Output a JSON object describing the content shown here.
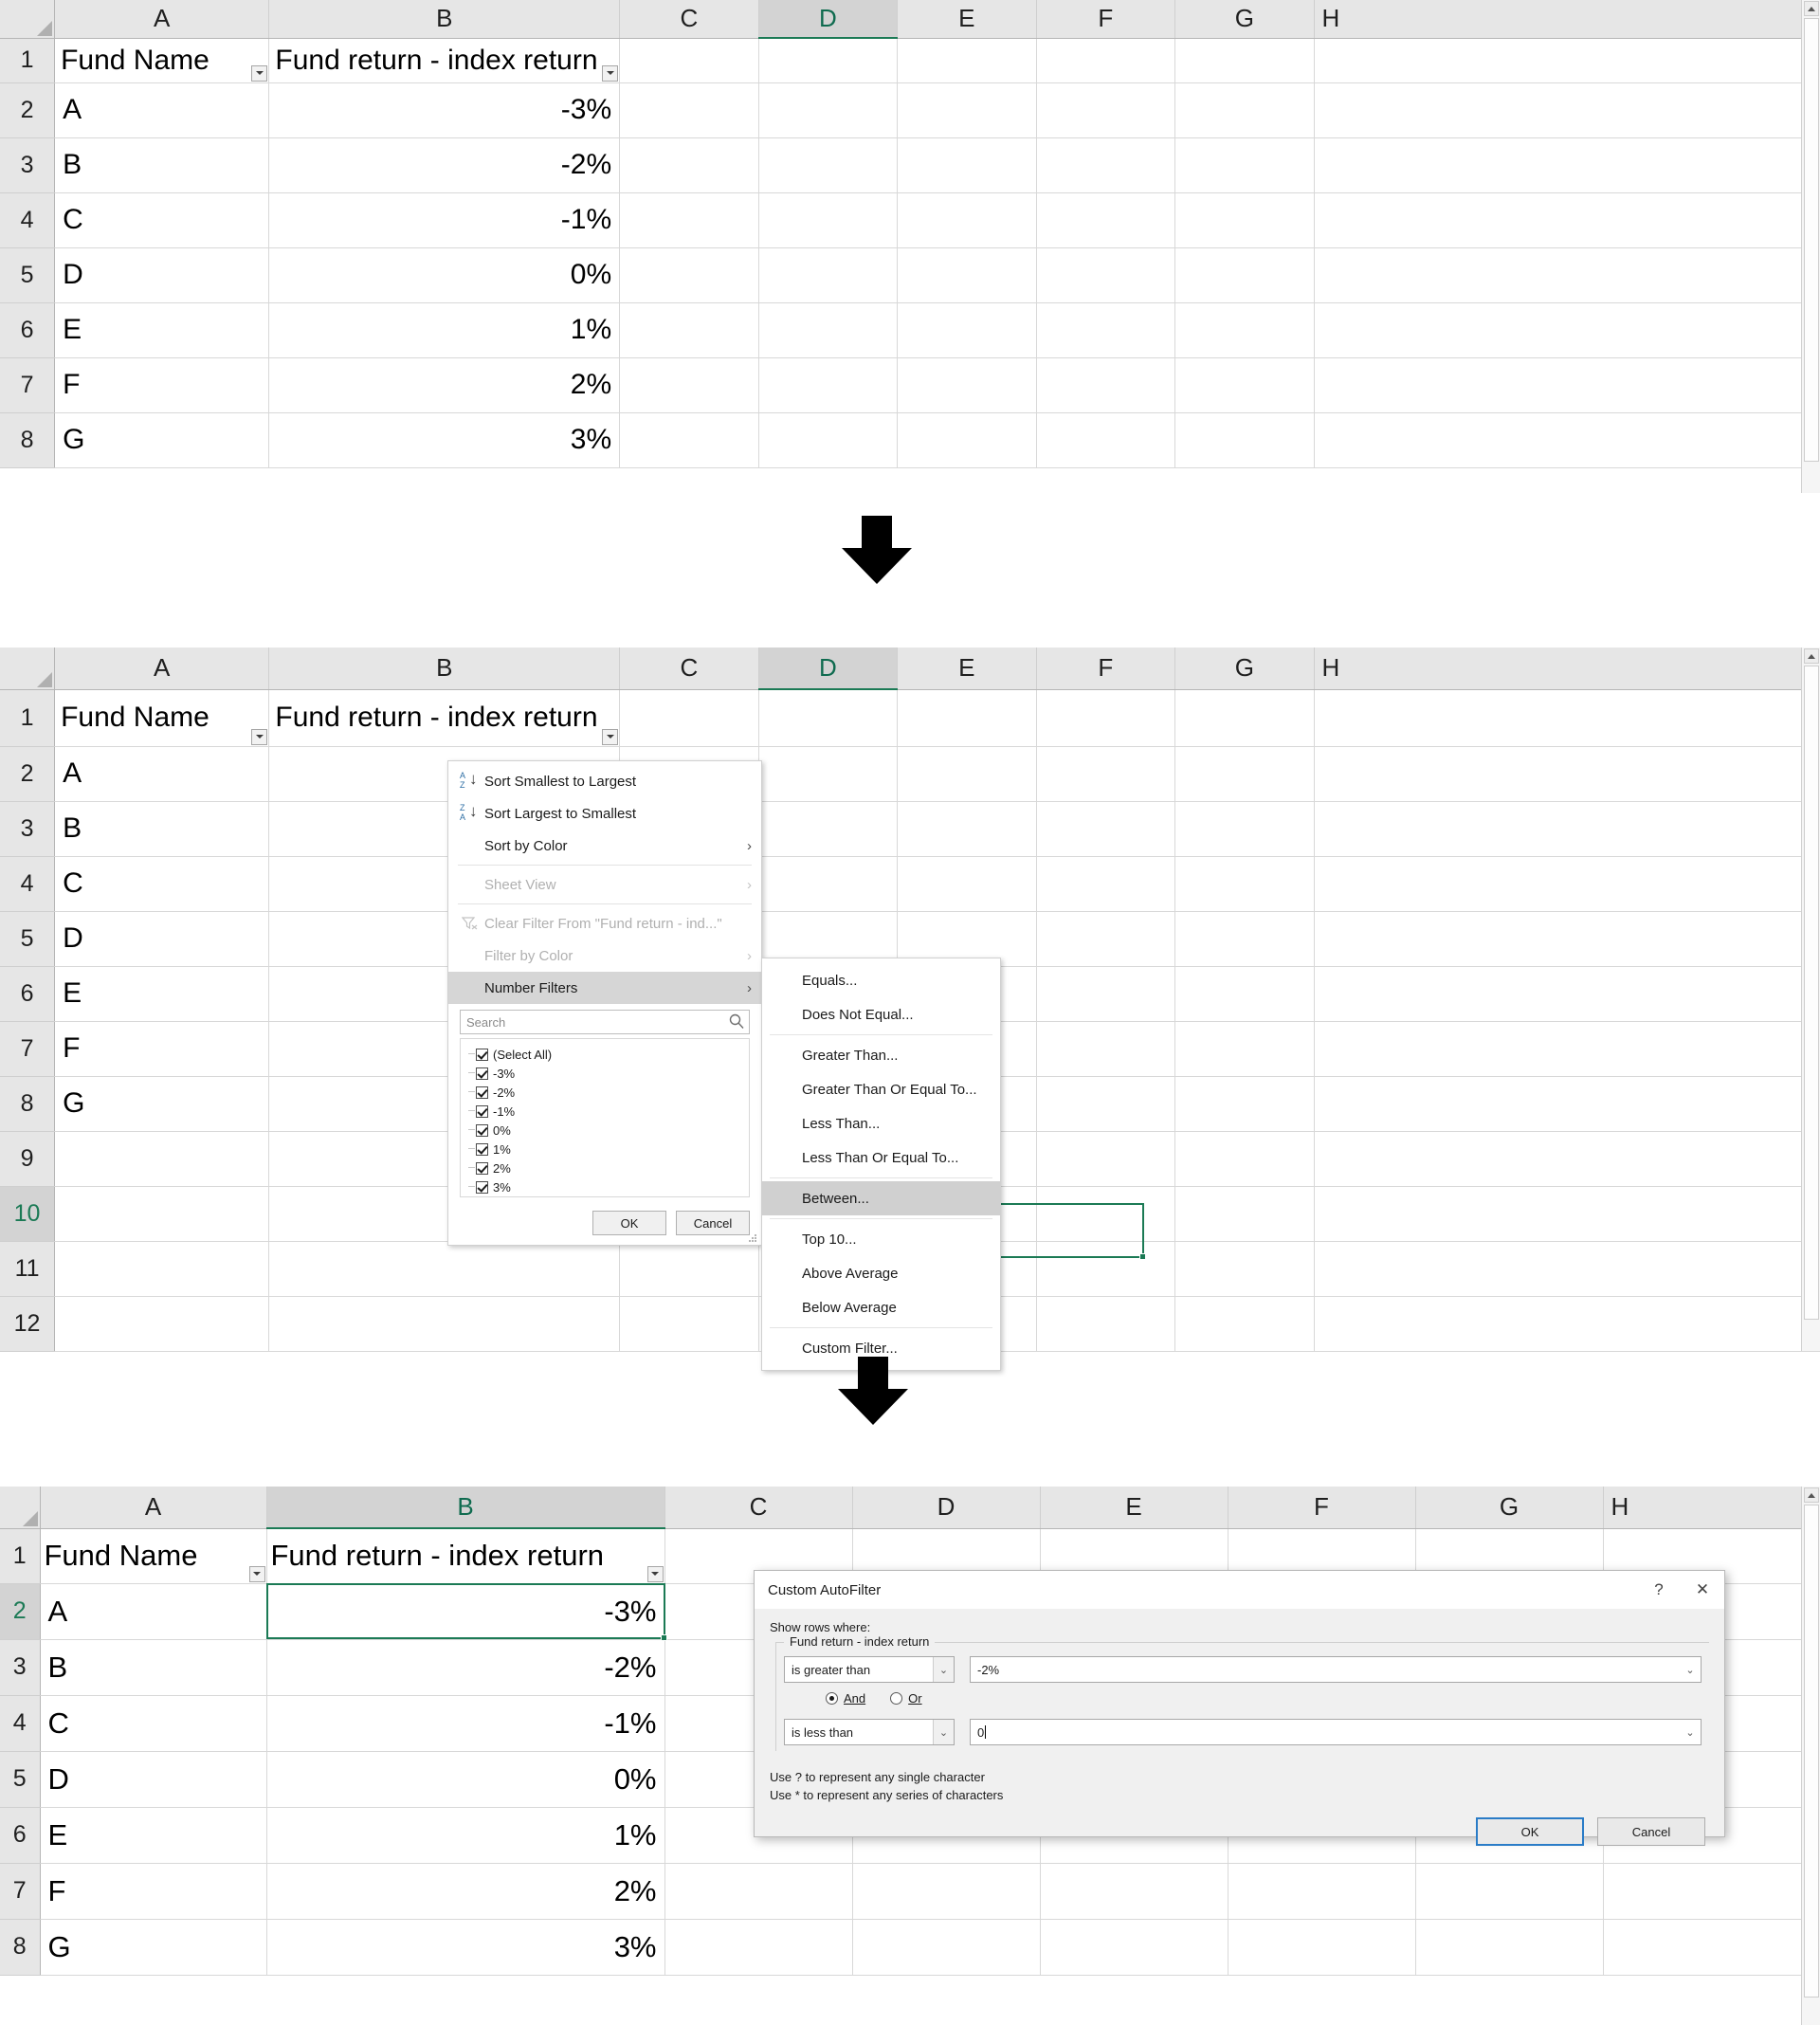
{
  "sheet": {
    "columns": [
      "A",
      "B",
      "C",
      "D",
      "E",
      "F",
      "G",
      "H"
    ],
    "header_row": {
      "a": "Fund Name",
      "b": "Fund return - index return"
    },
    "rows": [
      {
        "n": "2",
        "fund": "A",
        "value": "-3%"
      },
      {
        "n": "3",
        "fund": "B",
        "value": "-2%"
      },
      {
        "n": "4",
        "fund": "C",
        "value": "-1%"
      },
      {
        "n": "5",
        "fund": "D",
        "value": "0%"
      },
      {
        "n": "6",
        "fund": "E",
        "value": "1%"
      },
      {
        "n": "7",
        "fund": "F",
        "value": "2%"
      },
      {
        "n": "8",
        "fund": "G",
        "value": "3%"
      }
    ],
    "extra_row_numbers": [
      "9",
      "10",
      "11",
      "12"
    ],
    "row_header_1": "1"
  },
  "panel1": {
    "selected_column": "D"
  },
  "panel2": {
    "selected_column": "D",
    "selected_row": "10"
  },
  "panel3": {
    "selected_column": "B",
    "selected_row": "2"
  },
  "filter_menu": {
    "sort_smallest": "Sort Smallest to Largest",
    "sort_largest": "Sort Largest to Smallest",
    "sort_by_color": "Sort by Color",
    "sheet_view": "Sheet View",
    "clear_filter": "Clear Filter From \"Fund return - ind...\"",
    "filter_by_color": "Filter by Color",
    "number_filters": "Number Filters",
    "search_placeholder": "Search",
    "options": [
      "(Select All)",
      "-3%",
      "-2%",
      "-1%",
      "0%",
      "1%",
      "2%",
      "3%"
    ],
    "ok": "OK",
    "cancel": "Cancel",
    "chevron": "›",
    "sort_az_top": "A",
    "sort_az_bottom": "Z",
    "sort_za_top": "Z",
    "sort_za_bottom": "A",
    "sort_arrow": "↓",
    "search_icon": "⌕"
  },
  "number_filters_submenu": {
    "items": [
      "Equals...",
      "Does Not Equal...",
      "Greater Than...",
      "Greater Than Or Equal To...",
      "Less Than...",
      "Less Than Or Equal To...",
      "Between...",
      "Top 10...",
      "Above Average",
      "Below Average",
      "Custom Filter..."
    ],
    "highlighted": "Between..."
  },
  "custom_autofilter": {
    "title": "Custom AutoFilter",
    "help_icon": "?",
    "close_icon": "✕",
    "show_rows_where": "Show rows where:",
    "field_label": "Fund return - index return",
    "condition1_operator": "is greater than",
    "condition1_value": "-2%",
    "and_label": "And",
    "or_label": "Or",
    "condition2_operator": "is less than",
    "condition2_value": "0",
    "hint1": "Use ? to represent any single character",
    "hint2": "Use * to represent any series of characters",
    "ok": "OK",
    "cancel": "Cancel",
    "combo_arrow": "⌄"
  },
  "colors": {
    "accent_green": "#1b7a55",
    "header_gray": "#e6e6e6",
    "selected_header_gray": "#d3d3d3",
    "highlight_gray": "#d0d0d0",
    "primary_blue": "#2a7cc7"
  }
}
